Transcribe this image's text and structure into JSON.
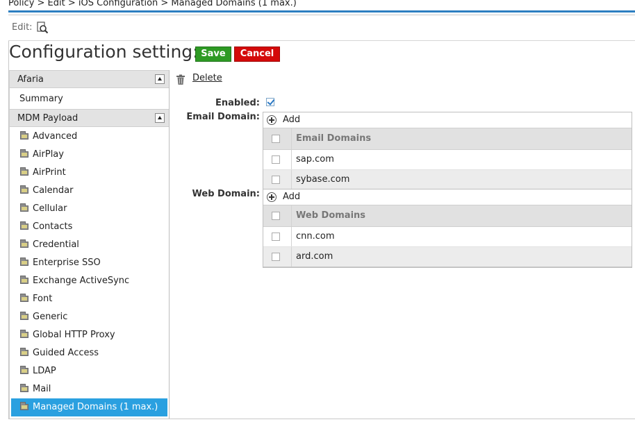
{
  "breadcrumb": "Policy > Edit > iOS Configuration > Managed Domains (1 max.)",
  "edit_bar": {
    "label": "Edit:",
    "preview_icon": "preview-magnifier-icon"
  },
  "page_title": "Configuration setting:",
  "buttons": {
    "save": "Save",
    "cancel": "Cancel"
  },
  "colors": {
    "accent": "#2d7fc1",
    "save": "#2e9a24",
    "cancel": "#d40a0a",
    "active_item": "#2aa0e0"
  },
  "sidebar": {
    "section1": "Afaria",
    "summary": "Summary",
    "section2": "MDM Payload",
    "items": [
      "Advanced",
      "AirPlay",
      "AirPrint",
      "Calendar",
      "Cellular",
      "Contacts",
      "Credential",
      "Enterprise SSO",
      "Exchange ActiveSync",
      "Font",
      "Generic",
      "Global HTTP Proxy",
      "Guided Access",
      "LDAP",
      "Mail",
      "Managed Domains (1 max.)"
    ],
    "active": "Managed Domains (1 max.)"
  },
  "content": {
    "delete_label": "Delete",
    "enabled_label": "Enabled:",
    "enabled": true,
    "email": {
      "label": "Email Domain:",
      "add_label": "Add",
      "header": "Email Domains",
      "rows": [
        "sap.com",
        "sybase.com"
      ]
    },
    "web": {
      "label": "Web Domain:",
      "add_label": "Add",
      "header": "Web Domains",
      "rows": [
        "cnn.com",
        "ard.com"
      ]
    }
  }
}
